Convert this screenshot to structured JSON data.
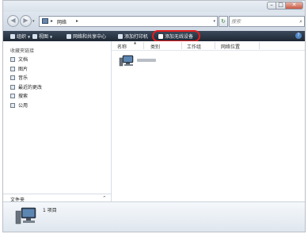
{
  "window": {
    "controls": {
      "minimize": "–",
      "maximize": "□",
      "close": "✕"
    }
  },
  "nav": {
    "back_icon": "back-arrow-icon",
    "forward_icon": "forward-arrow-icon",
    "history_dropdown": "▾"
  },
  "address": {
    "separator": "▸",
    "path": "网络",
    "dropdown": "▾"
  },
  "refresh": {
    "glyph": "↻"
  },
  "search": {
    "placeholder": "搜索",
    "icon": "⌕"
  },
  "toolbar": {
    "organize": "组织",
    "views": "视图",
    "network_center": "网络和共享中心",
    "add_printer": "添加打印机",
    "add_wireless": "添加无线设备",
    "highlight_color": "#e31d1d",
    "help": "?"
  },
  "sidebar": {
    "favorites_header": "收藏夹链接",
    "items": [
      {
        "label": "文档",
        "icon": "documents-icon"
      },
      {
        "label": "图片",
        "icon": "pictures-icon"
      },
      {
        "label": "音乐",
        "icon": "music-icon"
      },
      {
        "label": "最近的更改",
        "icon": "recent-changes-icon"
      },
      {
        "label": "搜索",
        "icon": "search-folder-icon"
      },
      {
        "label": "公用",
        "icon": "public-folder-icon"
      }
    ],
    "folders_label": "文件夹",
    "folders_caret": "^"
  },
  "columns": [
    "名称",
    "类别",
    "工作组",
    "网络位置"
  ],
  "details": {
    "count_text": "1 项目"
  }
}
